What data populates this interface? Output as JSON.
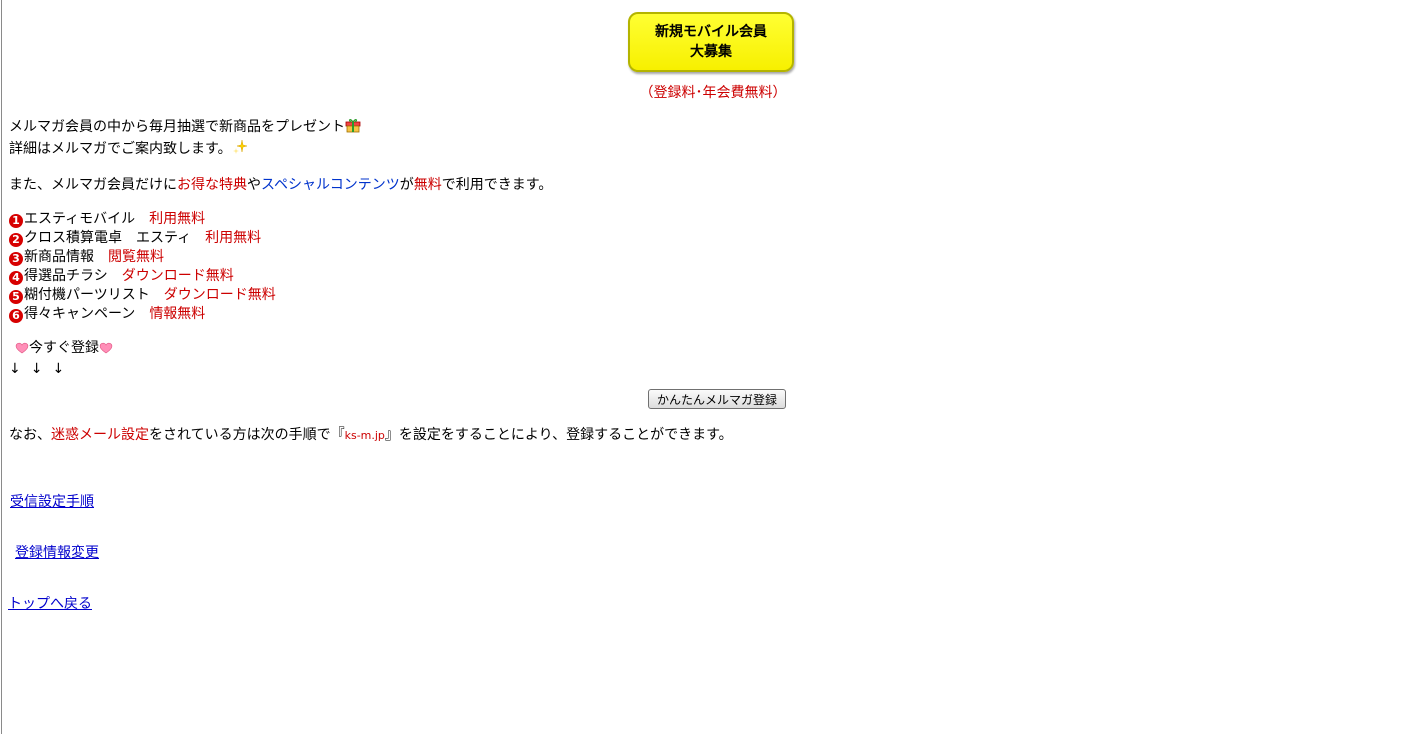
{
  "header": {
    "badge_line1": "新規モバイル会員",
    "badge_line2": "大募集",
    "fee_note": "（登録料･年会費無料）"
  },
  "intro": {
    "line1": "メルマガ会員の中から毎月抽選で新商品をプレゼント",
    "line2": "詳細はメルマガでご案内致します。",
    "benefits_prefix": "また、メルマガ会員だけに",
    "benefits_red": "お得な特典",
    "benefits_mid": "や",
    "benefits_blue": "スペシャルコンテンツ",
    "benefits_mid2": "が",
    "benefits_free": "無料",
    "benefits_suffix": "で利用できます。"
  },
  "benefit_list": [
    {
      "num": "1",
      "label": "エスティモバイル　",
      "status": "利用無料"
    },
    {
      "num": "2",
      "label": "クロス積算電卓　エスティ　",
      "status": "利用無料"
    },
    {
      "num": "3",
      "label": "新商品情報　",
      "status": "閲覧無料"
    },
    {
      "num": "4",
      "label": "得選品チラシ　",
      "status": "ダウンロード無料"
    },
    {
      "num": "5",
      "label": "糊付機パーツリスト　",
      "status": "ダウンロード無料"
    },
    {
      "num": "6",
      "label": "得々キャンペーン　",
      "status": "情報無料"
    }
  ],
  "cta": {
    "register_now": "今すぐ登録",
    "arrows": "↓↓↓",
    "button_label": "かんたんメルマガ登録"
  },
  "notice": {
    "prefix": "なお、",
    "spam_setting": "迷惑メール設定",
    "middle": "をされている方は次の手順で『",
    "domain": "ks-m.jp",
    "suffix": "』を設定をすることにより、登録することができます。"
  },
  "links": {
    "receive_settings": "受信設定手順",
    "change_registration": "登録情報変更",
    "back_to_top": "トップへ戻る"
  },
  "colors": {
    "accent_red": "#cc0000",
    "link_blue": "#0000cc",
    "badge_yellow": "#ffff33"
  }
}
